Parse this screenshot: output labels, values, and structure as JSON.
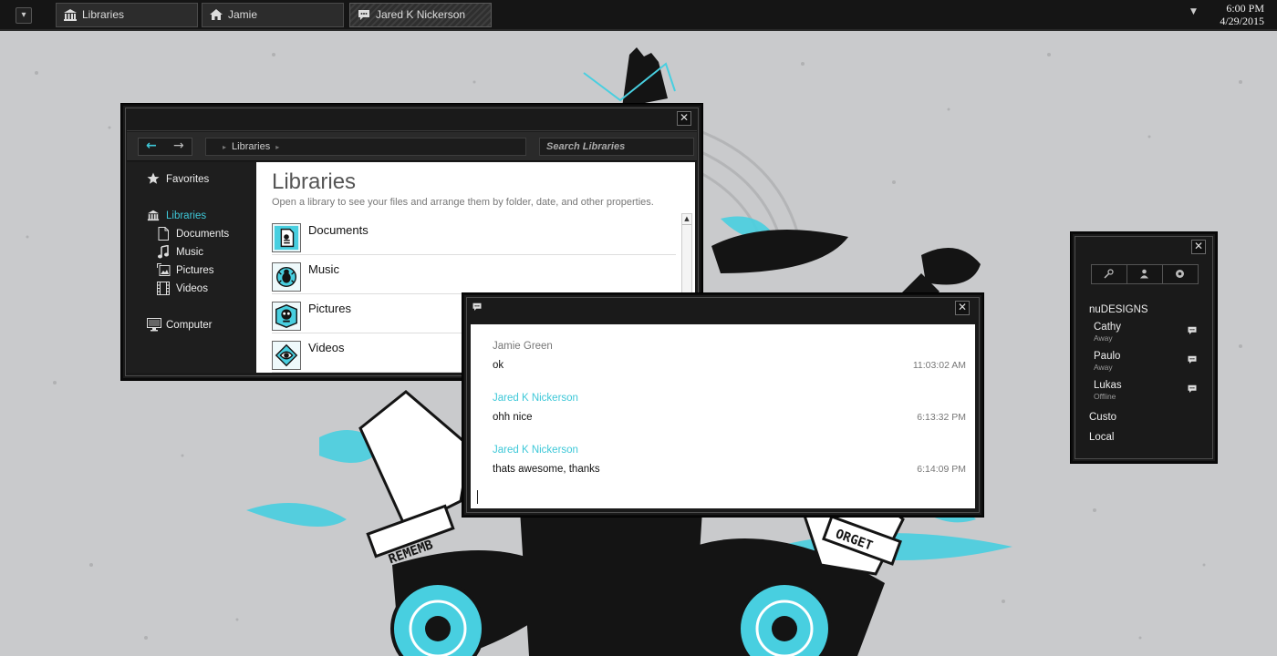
{
  "taskbar": {
    "buttons": [
      {
        "label": "Libraries",
        "icon": "library-icon"
      },
      {
        "label": "Jamie",
        "icon": "home-icon"
      },
      {
        "label": "Jared K Nickerson",
        "icon": "chat-icon",
        "active": true
      }
    ],
    "clock": {
      "time": "6:00 PM",
      "date": "4/29/2015"
    }
  },
  "explorer": {
    "breadcrumb": "Libraries",
    "search_placeholder": "Search Libraries",
    "sidebar": [
      {
        "label": "Favorites",
        "icon": "star-icon"
      },
      {
        "label": "Libraries",
        "icon": "library-icon",
        "active": true
      },
      {
        "label": "Documents",
        "icon": "document-icon"
      },
      {
        "label": "Music",
        "icon": "music-note-icon"
      },
      {
        "label": "Pictures",
        "icon": "picture-icon"
      },
      {
        "label": "Videos",
        "icon": "film-icon"
      },
      {
        "label": "Computer",
        "icon": "monitor-icon"
      }
    ],
    "title": "Libraries",
    "subtitle": "Open a library to see your files and arrange them by folder, date, and other properties.",
    "libraries": [
      "Documents",
      "Music",
      "Pictures",
      "Videos"
    ]
  },
  "chat": {
    "messages": [
      {
        "sender": "Jamie Green",
        "text": "ok",
        "time": "11:03:02 AM",
        "self": false
      },
      {
        "sender": "Jared K Nickerson",
        "text": "ohh nice",
        "time": "6:13:32 PM",
        "self": true
      },
      {
        "sender": "Jared K Nickerson",
        "text": "thats awesome, thanks",
        "time": "6:14:09 PM",
        "self": true
      }
    ]
  },
  "contacts": {
    "group": "nuDESIGNS",
    "people": [
      {
        "name": "Cathy",
        "status": "Away"
      },
      {
        "name": "Paulo",
        "status": "Away"
      },
      {
        "name": "Lukas",
        "status": "Offline"
      }
    ],
    "other_groups": [
      "Custo",
      "Local"
    ]
  },
  "colors": {
    "accent": "#3ec8d8",
    "window_bg": "#1a1a1a",
    "desktop_bg": "#c9cacc"
  }
}
